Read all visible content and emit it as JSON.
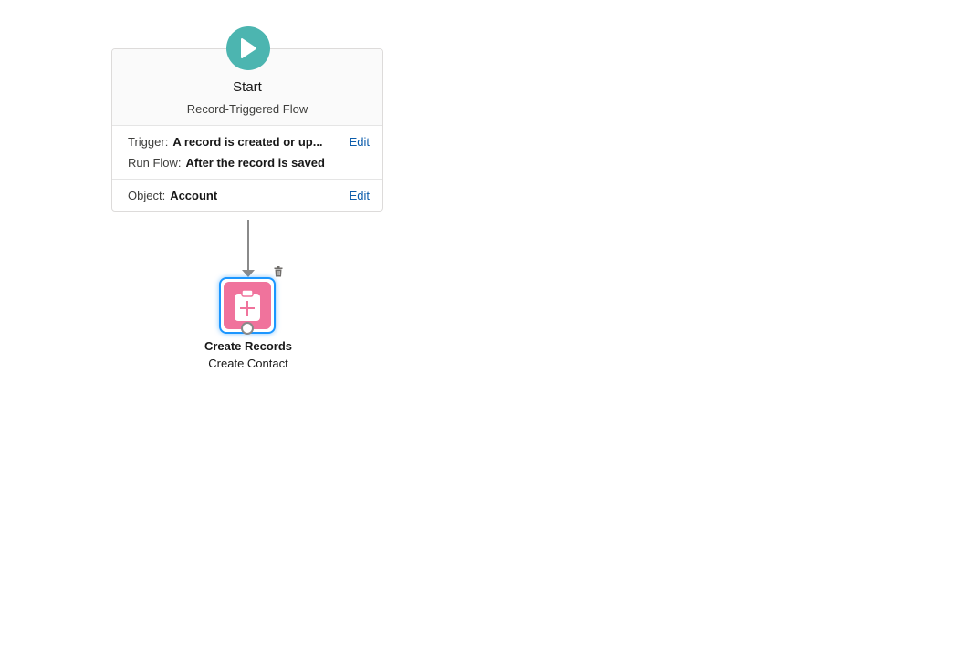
{
  "start": {
    "title": "Start",
    "subtitle": "Record-Triggered Flow",
    "trigger_label": "Trigger:",
    "trigger_value": "A record is created or up...",
    "run_flow_label": "Run Flow:",
    "run_flow_value": "After the record is saved",
    "object_label": "Object:",
    "object_value": "Account",
    "edit_label": "Edit",
    "icon": "play-icon",
    "color": "#4cb5b0"
  },
  "element": {
    "title": "Create Records",
    "subtitle": "Create Contact",
    "icon": "clipboard-plus-icon",
    "color": "#f0739c",
    "selection_color": "#1b96ff"
  }
}
